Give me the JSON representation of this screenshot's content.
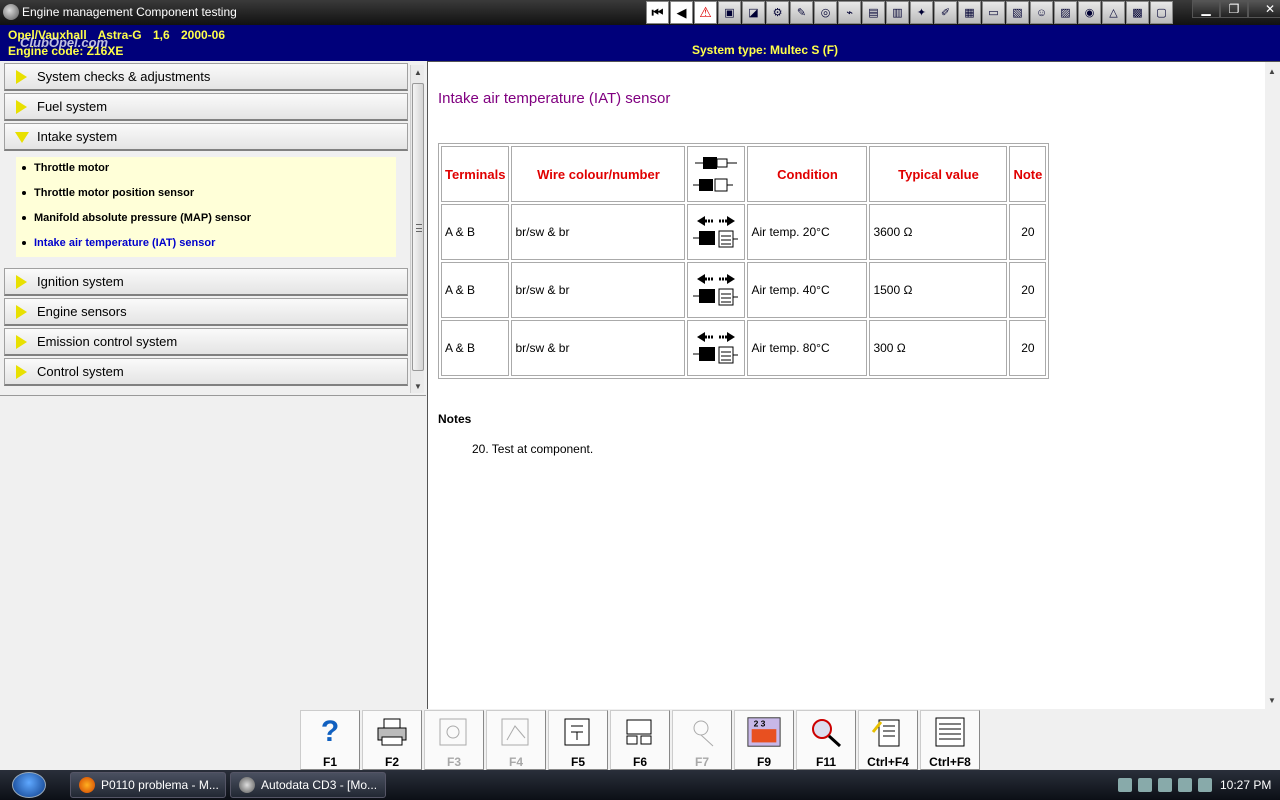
{
  "window": {
    "title": "Engine management Component testing",
    "controls": [
      "minimize",
      "maximize",
      "close"
    ]
  },
  "toolbar": {
    "icons": [
      "first-page",
      "previous-page",
      "warning",
      "tool-1",
      "tool-2",
      "tool-3",
      "tool-4",
      "tool-5",
      "tool-6",
      "tool-7",
      "tool-8",
      "tool-9",
      "tool-10",
      "tool-11",
      "tool-12",
      "tool-13",
      "tool-14",
      "tool-15",
      "tool-16",
      "tool-17",
      "tool-18",
      "tool-19",
      "tool-20",
      "tool-21"
    ]
  },
  "header": {
    "make": "Opel/Vauxhall",
    "model": "Astra-G",
    "engine_size": "1,6",
    "year": "2000-06",
    "engine_code": "Engine code: Z16XE",
    "system_type": "System type: Multec S (F)",
    "watermark": "ClubOpel.com"
  },
  "sidebar": {
    "categories": [
      {
        "label": "System checks & adjustments",
        "open": false
      },
      {
        "label": "Fuel system",
        "open": false
      },
      {
        "label": "Intake system",
        "open": true
      },
      {
        "label": "Ignition system",
        "open": false
      },
      {
        "label": "Engine sensors",
        "open": false
      },
      {
        "label": "Emission control system",
        "open": false
      },
      {
        "label": "Control system",
        "open": false
      }
    ],
    "subitems": [
      {
        "label": "Throttle motor",
        "active": false
      },
      {
        "label": "Throttle motor position sensor",
        "active": false
      },
      {
        "label": "Manifold absolute pressure (MAP) sensor",
        "active": false
      },
      {
        "label": "Intake air temperature (IAT) sensor",
        "active": true
      }
    ]
  },
  "content": {
    "title": "Intake air temperature (IAT) sensor",
    "table": {
      "headers": [
        "Terminals",
        "Wire colour/number",
        "",
        "Condition",
        "Typical value",
        "Note"
      ],
      "rows": [
        {
          "terminals": "A & B",
          "wire": "br/sw & br",
          "condition": "Air temp. 20°C",
          "value": "3600 Ω",
          "note": "20"
        },
        {
          "terminals": "A & B",
          "wire": "br/sw & br",
          "condition": "Air temp. 40°C",
          "value": "1500 Ω",
          "note": "20"
        },
        {
          "terminals": "A & B",
          "wire": "br/sw & br",
          "condition": "Air temp. 80°C",
          "value": "300 Ω",
          "note": "20"
        }
      ]
    },
    "notes_heading": "Notes",
    "notes": [
      "20. Test at component."
    ]
  },
  "fkeys": [
    {
      "label": "F1",
      "icon": "help-icon",
      "enabled": true
    },
    {
      "label": "F2",
      "icon": "print-icon",
      "enabled": true
    },
    {
      "label": "F3",
      "icon": "diagram-icon",
      "enabled": false
    },
    {
      "label": "F4",
      "icon": "diagram-alt-icon",
      "enabled": false
    },
    {
      "label": "F5",
      "icon": "component-icon",
      "enabled": true
    },
    {
      "label": "F6",
      "icon": "connector-icon",
      "enabled": true
    },
    {
      "label": "F7",
      "icon": "location-icon",
      "enabled": false
    },
    {
      "label": "F9",
      "icon": "fault-codes-icon",
      "enabled": true
    },
    {
      "label": "F11",
      "icon": "search-icon",
      "enabled": true
    },
    {
      "label": "Ctrl+F4",
      "icon": "notes-icon",
      "enabled": true
    },
    {
      "label": "Ctrl+F8",
      "icon": "list-icon",
      "enabled": true
    }
  ],
  "taskbar": {
    "tasks": [
      "P0110 problema - M...",
      "Autodata CD3 - [Mo..."
    ],
    "clock": "10:27 PM"
  }
}
